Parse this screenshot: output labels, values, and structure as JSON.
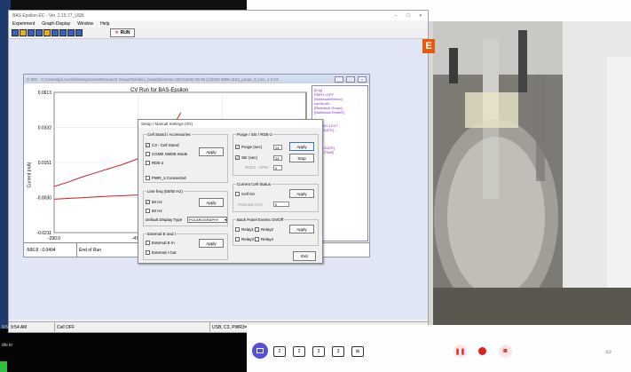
{
  "window": {
    "title": "BAS Epsilon-EC - Ver. 2.15.77_USB",
    "controls": [
      "–",
      "☐",
      "✕"
    ]
  },
  "menu": [
    "Experiment",
    "Graph-Display",
    "Window",
    "Help"
  ],
  "toolbar": {
    "run_label": "RUN"
  },
  "cv": {
    "title": "C:\\RO - C:\\Users\\jpx.curri\\Desktop\\Users\\Research Group\\Temelini_bradd\\Summer 2021\\2020 08 06 (c)2020 0806 1153_purge_5_min_1.CV3",
    "plot_title": "CV Run for BAS-Epsilon",
    "ylabel": "Current (mA)",
    "footer": {
      "coords": "-566.8 : 0.0494",
      "status": "End of Run"
    },
    "legend_lines": [
      "[Exp]",
      "PWR1=OFF",
      "[Notebook/Memo]",
      "curr/trudi/...",
      "[Research Group]",
      "[Notebook/TemelS]",
      "...",
      "[CV]",
      "4/8/2020 12:47 ...",
      "A/4(3/DATE)...",
      "...",
      "",
      "[IT]",
      "A/4/[1/DATE]",
      "A/4/[1/TIME]",
      "...",
      "",
      "[RT]",
      "..."
    ]
  },
  "chart_data": {
    "type": "line",
    "title": "CV Run for BAS-Epsilon",
    "xlabel": "",
    "ylabel": "Current (mA)",
    "x_ticks": [
      "-290.0",
      "-473.5",
      "-656.8"
    ],
    "y_ticks": [
      "0.0613",
      "0.0332",
      "0.0151",
      "-0.0030",
      "-0.0211"
    ],
    "xlim": [
      -290.0,
      -840.0
    ],
    "ylim": [
      -0.0211,
      0.0613
    ],
    "series": [
      {
        "x": [
          -290,
          -320,
          -350,
          -380,
          -410,
          -440,
          -470,
          -500,
          -530,
          -566.8
        ],
        "y": [
          0.006,
          0.0085,
          0.0115,
          0.014,
          0.0165,
          0.019,
          0.022,
          0.026,
          0.033,
          0.0494
        ],
        "color": "#cc2222"
      },
      {
        "x": [
          -290,
          -320,
          -350,
          -380,
          -410,
          -440,
          -470,
          -500,
          -530,
          -566.8
        ],
        "y": [
          -0.0015,
          -0.001,
          -0.0006,
          -0.0001,
          0.0003,
          0.0006,
          0.001,
          0.002,
          0.0035,
          0.005
        ],
        "color": "#cc2222"
      }
    ]
  },
  "dialog": {
    "title": "Setup / Manual Settings (I/O)",
    "cell_stand": {
      "label": "Cell Stand / Accessories",
      "c3": "C3 - Cell Stand",
      "cgme": "CGME SMDE Mode",
      "rde": "RDE-2",
      "pwr": "PWR_3 Connected",
      "apply": "Apply"
    },
    "line_freq": {
      "label": "Line freq (50/60 Hz)",
      "hz50": "50 Hz",
      "hz60": "60 Hz",
      "display_type_label": "Default Display Type",
      "display_type_value": "POLAROGRAPHY",
      "apply": "Apply"
    },
    "ext": {
      "label": "External E and I",
      "in": "External E In",
      "out": "External I Out",
      "apply": "Apply"
    },
    "purge": {
      "label": "Purge / Stir / RDE-2",
      "purge_label": "Purge (sec)",
      "purge_value": "24",
      "stir_label": "Stir (sec)",
      "stir_value": "24",
      "rde_label": "RDE2 - RPM",
      "rde_value": "0",
      "apply": "Apply",
      "stop": "Stop"
    },
    "cell_status": {
      "label": "Current Cell Status",
      "cell_on": "Cell On",
      "potential_label": "Potential (mV)",
      "potential_value": "0",
      "apply": "Apply"
    },
    "back_panel": {
      "label": "Back Panel Events On/Off",
      "relay1": "Relay1",
      "relay2": "Relay2",
      "relay3": "Relay3",
      "relay4": "Relay4",
      "apply": "Apply"
    },
    "exit": "Exit"
  },
  "status": {
    "time": "9:54 AM",
    "cell": "Cell OFF",
    "conn": "USB, C3, PWR3=Off"
  },
  "desktop": {
    "label": "dio io"
  },
  "controls_bar": {
    "layouts": [
      "1",
      "2",
      "2",
      "3",
      "3"
    ],
    "accent": "#5550d8",
    "record_color": "#e02020"
  }
}
